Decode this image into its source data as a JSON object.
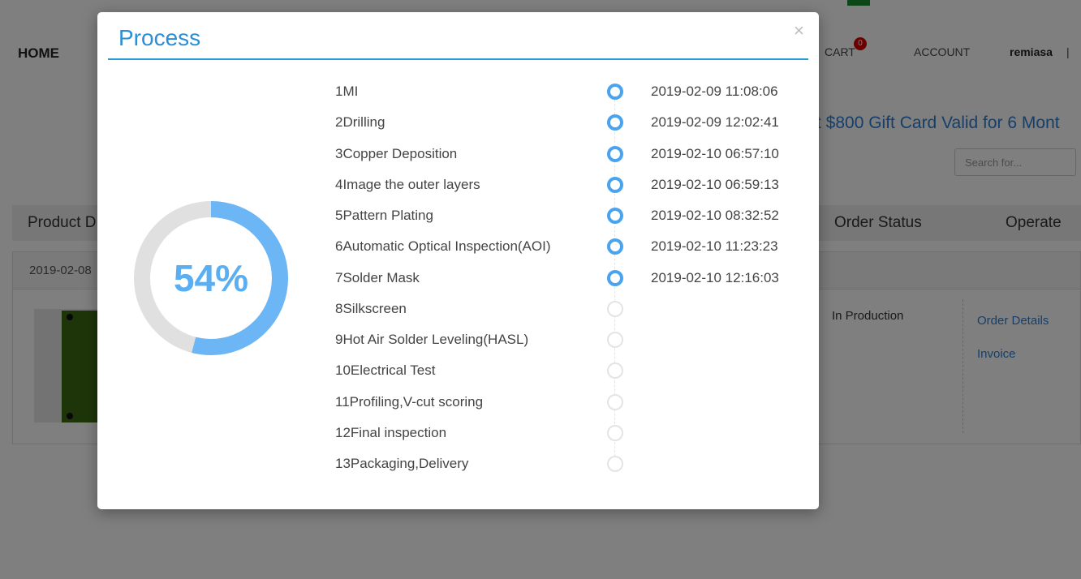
{
  "background": {
    "nav": {
      "home": "HOME",
      "cart": "CART",
      "cart_count": "0",
      "account": "ACCOUNT",
      "user": "remiasa",
      "separator": "|"
    },
    "promo_text": "t $800 Gift Card Valid for 6 Mont",
    "search_placeholder": "Search for...",
    "table_headers": {
      "product": "Product D",
      "order_status": "Order Status",
      "operate": "Operate"
    },
    "order": {
      "date": "2019-02-08",
      "status": "In Production",
      "details_link": "Order Details",
      "invoice_link": "Invoice"
    }
  },
  "modal": {
    "title": "Process",
    "close_label": "×",
    "progress_percent": 54,
    "progress_label": "54%",
    "colors": {
      "accent": "#4aa3ee",
      "ring_track": "#e0e0e0",
      "ring_fill": "#6cb6f5",
      "pending": "#e4e4e4"
    },
    "steps": [
      {
        "label": "1MI",
        "time": "2019-02-09 11:08:06",
        "done": true
      },
      {
        "label": "2Drilling",
        "time": "2019-02-09 12:02:41",
        "done": true
      },
      {
        "label": "3Copper Deposition",
        "time": "2019-02-10 06:57:10",
        "done": true
      },
      {
        "label": "4Image the outer layers",
        "time": "2019-02-10 06:59:13",
        "done": true
      },
      {
        "label": "5Pattern Plating",
        "time": "2019-02-10 08:32:52",
        "done": true
      },
      {
        "label": "6Automatic Optical Inspection(AOI)",
        "time": "2019-02-10 11:23:23",
        "done": true
      },
      {
        "label": "7Solder Mask",
        "time": "2019-02-10 12:16:03",
        "done": true
      },
      {
        "label": "8Silkscreen",
        "time": "",
        "done": false
      },
      {
        "label": "9Hot Air Solder Leveling(HASL)",
        "time": "",
        "done": false
      },
      {
        "label": "10Electrical Test",
        "time": "",
        "done": false
      },
      {
        "label": "11Profiling,V-cut scoring",
        "time": "",
        "done": false
      },
      {
        "label": "12Final inspection",
        "time": "",
        "done": false
      },
      {
        "label": "13Packaging,Delivery",
        "time": "",
        "done": false
      }
    ]
  }
}
